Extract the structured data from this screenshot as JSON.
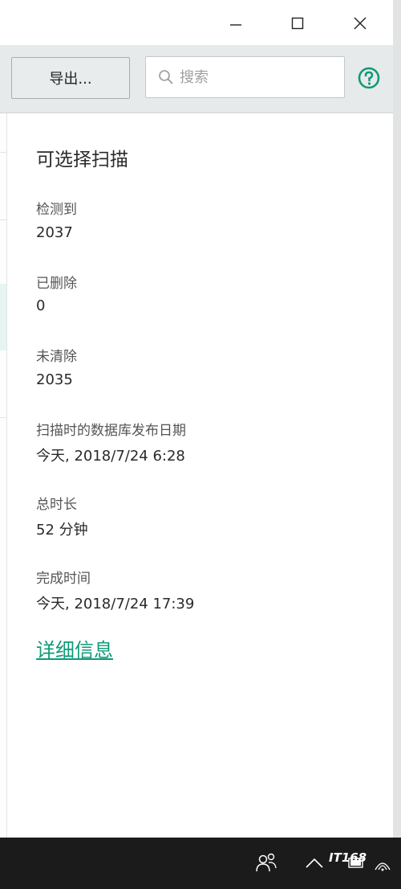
{
  "colors": {
    "accent": "#0f9a78",
    "toolbar_bg": "#e7eaea",
    "taskbar_bg": "#1b1b1b"
  },
  "window_controls": {
    "minimize_icon": "minimize-icon",
    "maximize_icon": "maximize-icon",
    "close_icon": "close-icon"
  },
  "toolbar": {
    "export_label": "导出...",
    "search_placeholder": "搜索",
    "help_icon": "help-icon"
  },
  "details": {
    "title": "可选择扫描",
    "fields": [
      {
        "label": "检测到",
        "value": "2037"
      },
      {
        "label": "已删除",
        "value": "0"
      },
      {
        "label": "未清除",
        "value": "2035"
      },
      {
        "label": "扫描时的数据库发布日期",
        "value": "今天, 2018/7/24 6:28"
      },
      {
        "label": "总时长",
        "value": "52 分钟"
      },
      {
        "label": "完成时间",
        "value": "今天, 2018/7/24 17:39"
      }
    ],
    "link": "详细信息"
  },
  "taskbar": {
    "icons": [
      "people-icon",
      "chevron-up-icon",
      "battery-icon",
      "wifi-icon"
    ],
    "watermark": "IT168"
  }
}
